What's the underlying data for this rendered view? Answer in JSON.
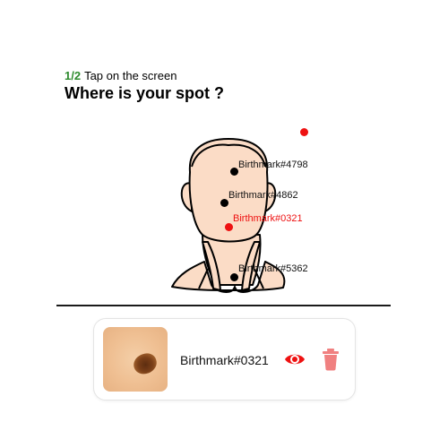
{
  "header": {
    "step_count": "1/2",
    "step_text": "Tap on the screen",
    "title": "Where is your spot ?"
  },
  "markers": [
    {
      "label": "Birthmark#4798",
      "selected": false
    },
    {
      "label": "Birthmark#4862",
      "selected": false
    },
    {
      "label": "Birthmark#0321",
      "selected": true
    },
    {
      "label": "Birthmark#5362",
      "selected": false
    }
  ],
  "selected_spot": {
    "name": "Birthmark#0321",
    "view_icon": "eye-icon",
    "delete_icon": "trash-icon"
  },
  "colors": {
    "accent_red": "#ee1111",
    "step_green": "#2e8b2e",
    "skin": "#fbdcc6",
    "delete_red": "#f08080"
  }
}
